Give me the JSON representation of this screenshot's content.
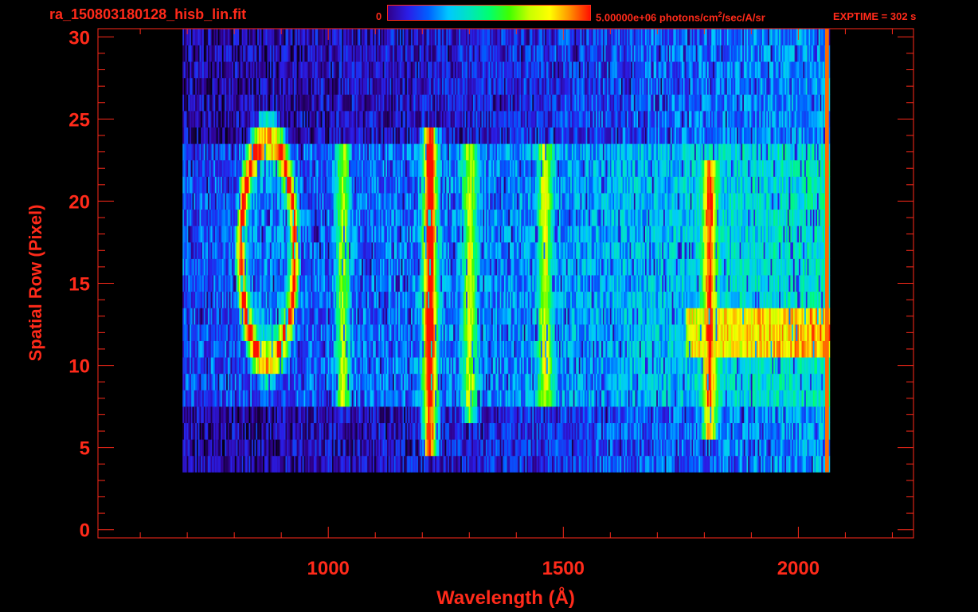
{
  "header": {
    "file_title": "ra_150803180128_hisb_lin.fit",
    "colorbar_min": "0",
    "colorbar_max": "5.00000e+06 photons/cm",
    "colorbar_max_sup": "2",
    "colorbar_max_tail": "/sec/A/sr",
    "exptime": "EXPTIME = 302 s"
  },
  "colors": {
    "axis": "#ff2a1a",
    "background": "#000000",
    "colormap": [
      "#000000",
      "#30008a",
      "#2a1ee8",
      "#0060ff",
      "#00c8ff",
      "#00e4c0",
      "#00ff70",
      "#40ff00",
      "#c8ff00",
      "#ffff00",
      "#ff9000",
      "#ff1000"
    ]
  },
  "chart_data": {
    "type": "heatmap",
    "title": "ra_150803180128_hisb_lin.fit",
    "xlabel": "Wavelength (Å)",
    "ylabel": "Spatial Row (Pixel)",
    "xlim": [
      510,
      2245
    ],
    "ylim": [
      -0.5,
      30.5
    ],
    "xticks": [
      1000,
      1500,
      2000
    ],
    "yticks": [
      0,
      5,
      10,
      15,
      20,
      25,
      30
    ],
    "colorbar": {
      "min": 0,
      "max": 5000000,
      "units": "photons/cm^2/sec/A/sr"
    },
    "grid": false,
    "data_extent": {
      "x": [
        690,
        2065
      ],
      "rows": [
        4,
        30
      ]
    },
    "features": [
      {
        "type": "ring",
        "center_x": 870,
        "center_y": 17,
        "rx": 60,
        "ry": 7,
        "intensity": 0.85
      },
      {
        "type": "line",
        "x": 1215,
        "rows": [
          5,
          24
        ],
        "intensity": 0.85
      },
      {
        "type": "line",
        "x": 1030,
        "rows": [
          8,
          23
        ],
        "intensity": 0.45
      },
      {
        "type": "line",
        "x": 1300,
        "rows": [
          7,
          23
        ],
        "intensity": 0.45
      },
      {
        "type": "line",
        "x": 1460,
        "rows": [
          8,
          23
        ],
        "intensity": 0.45
      },
      {
        "type": "line",
        "x": 1810,
        "rows": [
          6,
          22
        ],
        "intensity": 0.6
      },
      {
        "type": "band",
        "x": [
          1760,
          2065
        ],
        "rows": [
          11,
          13
        ],
        "intensity": 0.78
      }
    ]
  }
}
